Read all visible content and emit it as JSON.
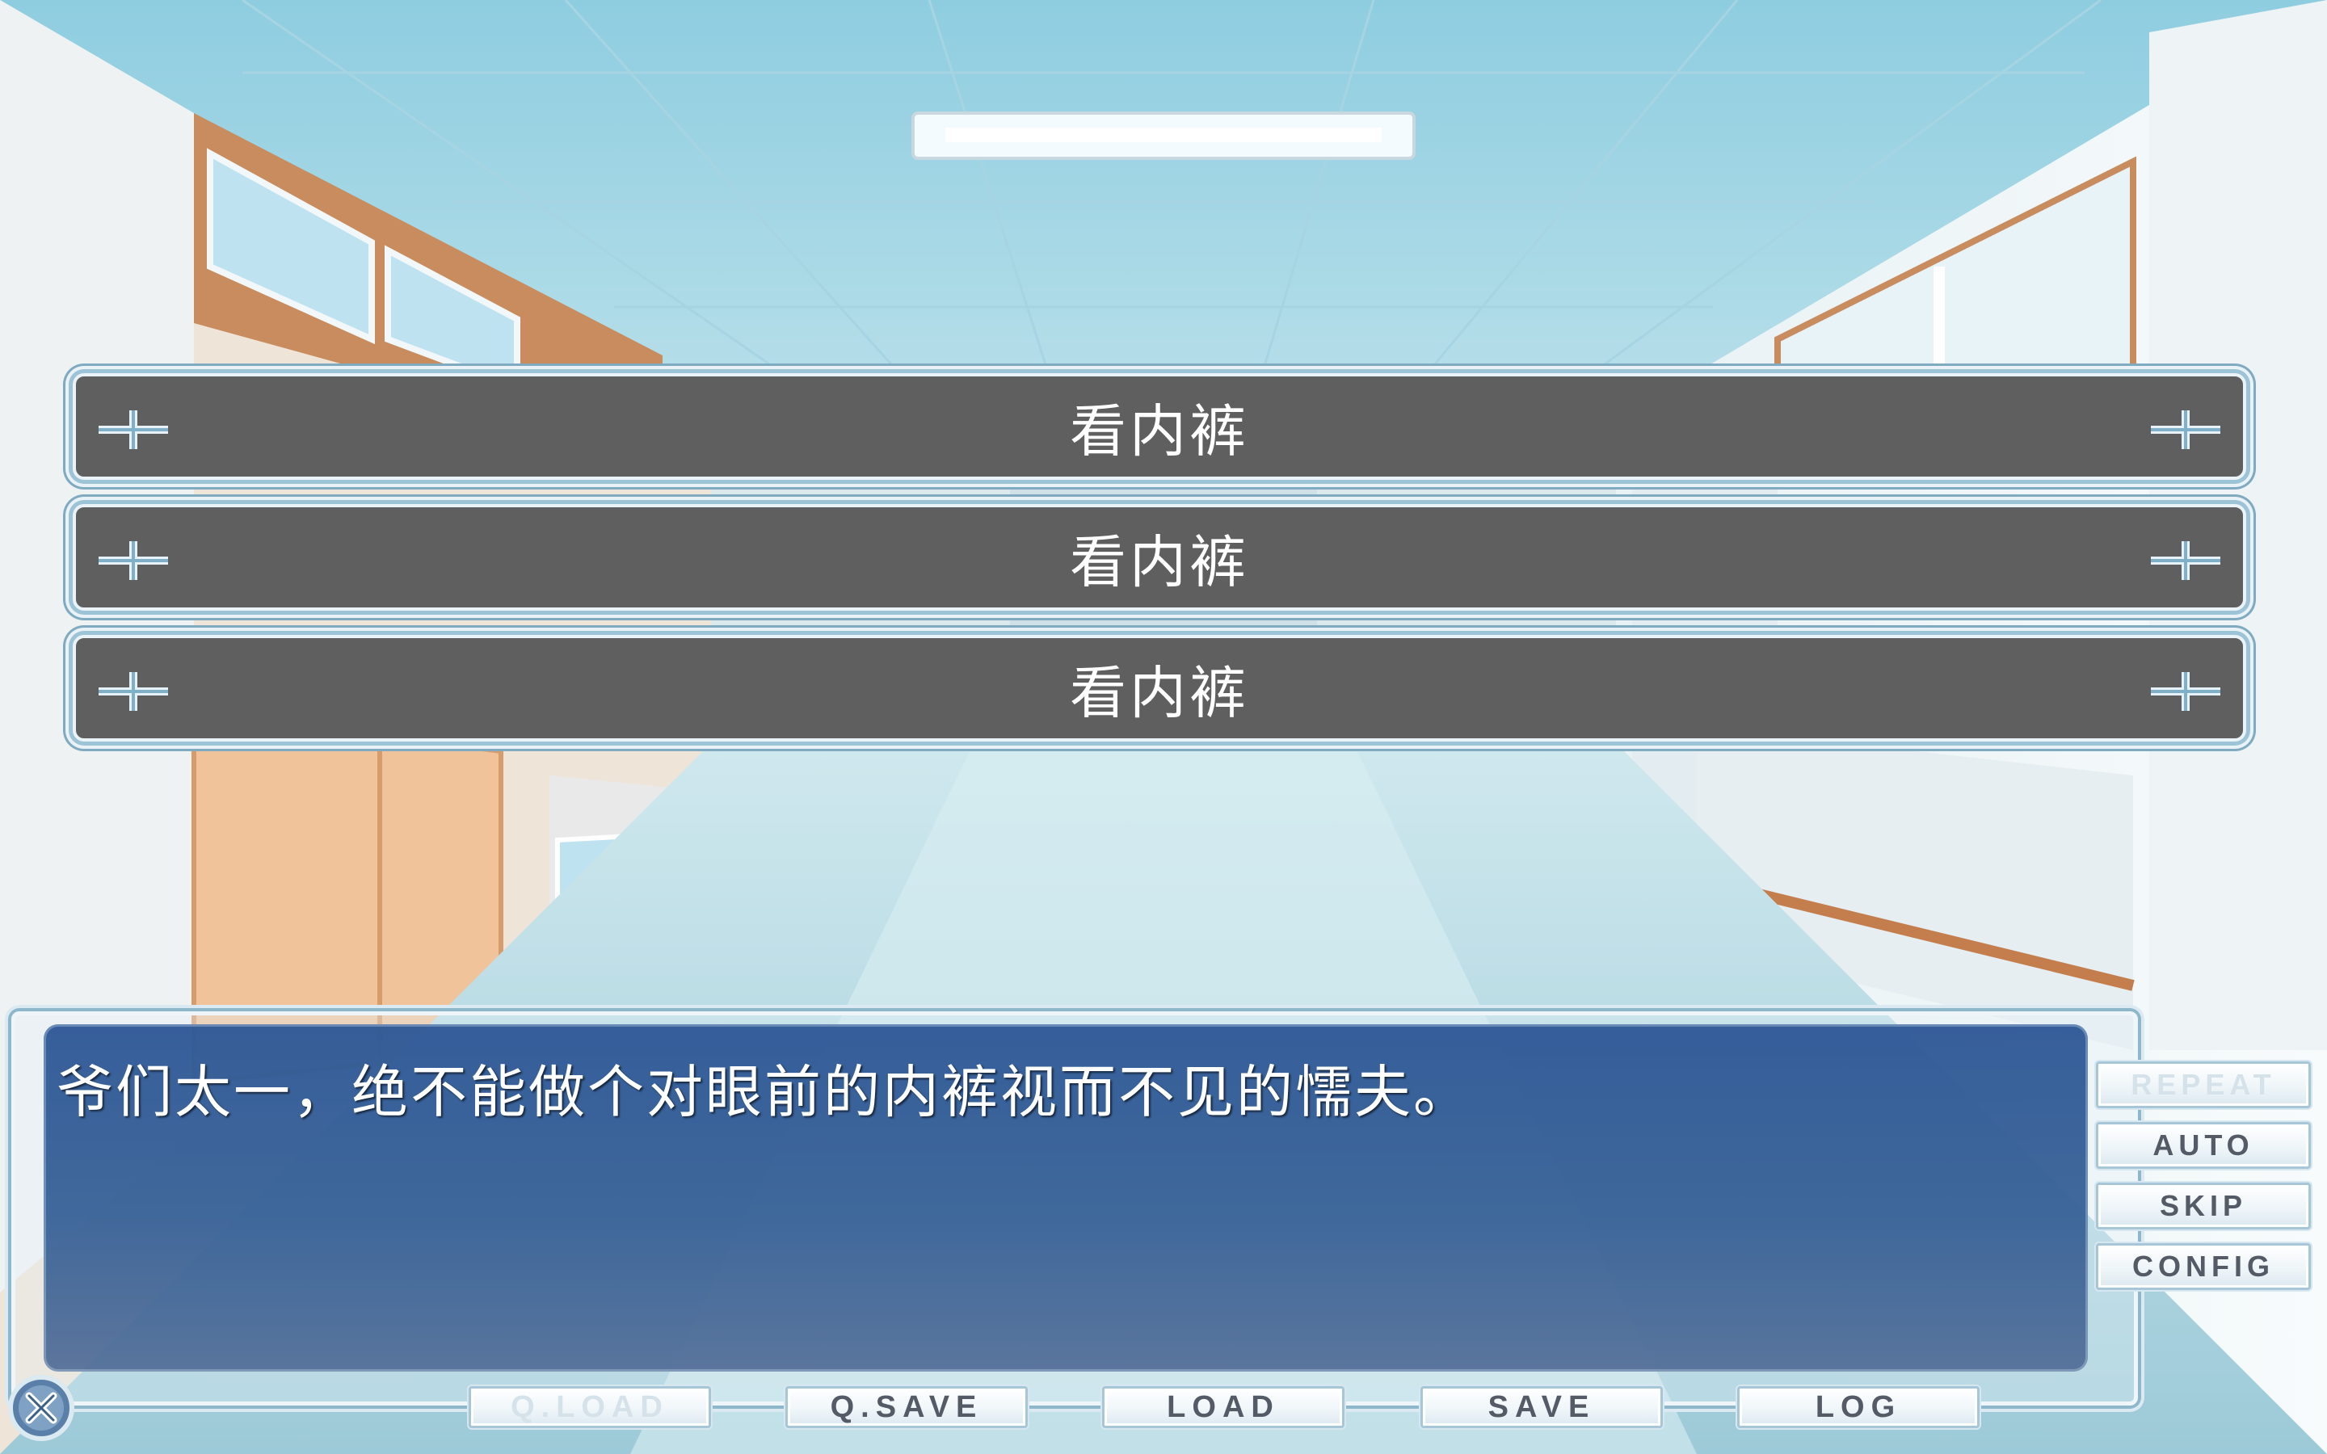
{
  "choices": [
    {
      "label": "看内裤"
    },
    {
      "label": "看内裤"
    },
    {
      "label": "看内裤"
    }
  ],
  "message": {
    "text": "爷们太一，绝不能做个对眼前的内裤视而不见的懦夫。"
  },
  "side_buttons": {
    "repeat": "REPEAT",
    "auto": "AUTO",
    "skip": "SKIP",
    "config": "CONFIG"
  },
  "bottom_buttons": {
    "qload": "Q.LOAD",
    "qsave": "Q.SAVE",
    "load": "LOAD",
    "save": "SAVE",
    "log": "LOG"
  },
  "icons": {
    "close": "close-icon",
    "choice_ornament": "cross-ornament-icon"
  },
  "colors": {
    "choice_bg": "#5f5f5f",
    "message_bg": "#2f5896",
    "button_text": "#555b66",
    "disabled_text": "#d5e2ea"
  }
}
